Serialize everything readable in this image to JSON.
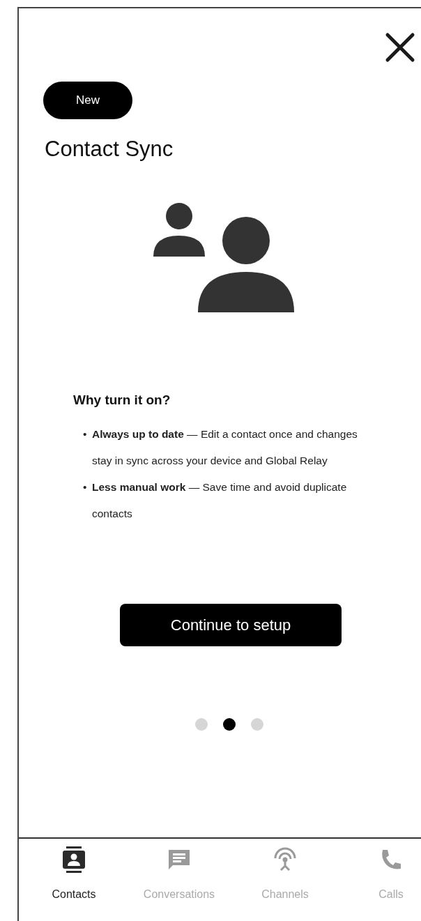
{
  "badge": "New",
  "title": "Contact Sync",
  "why": {
    "heading": "Why turn it on?",
    "bullets": [
      {
        "marker": "•",
        "text": "**Always up to date** — Edit a contact once and changes stay in sync across your device and Global Relay"
      },
      {
        "marker": "•",
        "text": "**Less manual work** — Save time and avoid duplicate contacts"
      }
    ]
  },
  "button": "Continue to setup",
  "pages": [
    {
      "selected": false
    },
    {
      "selected": true
    },
    {
      "selected": false
    }
  ],
  "nav": [
    {
      "kind": "contacts",
      "label": "Contacts",
      "selected": true
    },
    {
      "kind": "conversations",
      "label": "Conversations",
      "selected": false
    },
    {
      "kind": "channels",
      "label": "Channels",
      "selected": false
    },
    {
      "kind": "calls",
      "label": "Calls",
      "selected": false
    }
  ]
}
